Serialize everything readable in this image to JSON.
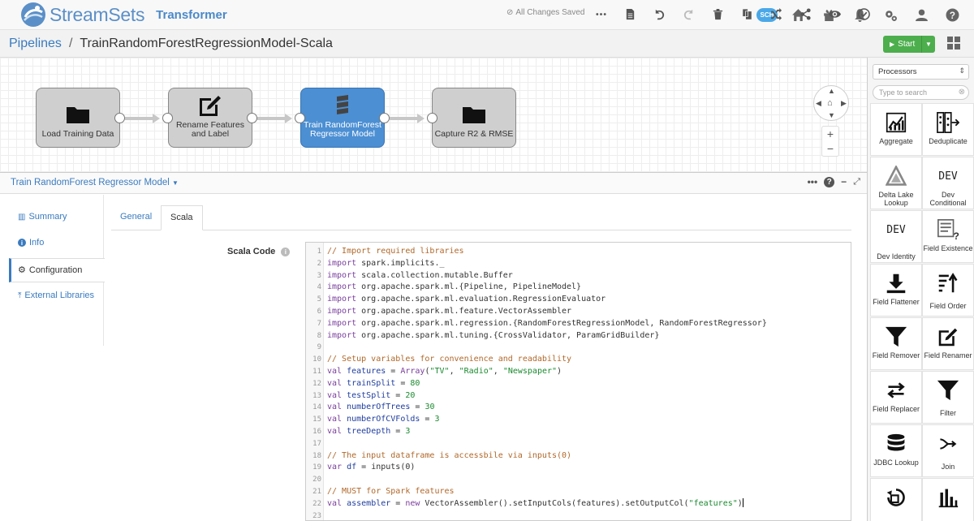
{
  "app": {
    "brand": "StreamSets",
    "product": "Transformer",
    "sch_badge": "SCH"
  },
  "breadcrumb": {
    "root": "Pipelines",
    "separator": "/",
    "pipeline_title": "TrainRandomForestRegressionModel-Scala"
  },
  "toolbar": {
    "saved_status": "All Changes Saved",
    "start_label": "Start"
  },
  "pipeline": {
    "stages": [
      {
        "label": "Load Training Data",
        "icon": "folder-icon"
      },
      {
        "label": "Rename Features and Label",
        "icon": "edit-icon"
      },
      {
        "label": "Train RandomForest Regressor Model",
        "icon": "scala-icon"
      },
      {
        "label": "Capture R2 & RMSE",
        "icon": "folder-icon"
      }
    ]
  },
  "config": {
    "title": "Train RandomForest Regressor Model",
    "nav": [
      {
        "label": "Summary",
        "icon": "bar-chart-icon"
      },
      {
        "label": "Info",
        "icon": "info-icon"
      },
      {
        "label": "Configuration",
        "icon": "gear-icon"
      },
      {
        "label": "External Libraries",
        "icon": "upload-icon"
      }
    ],
    "tabs": [
      "General",
      "Scala"
    ],
    "field_label": "Scala Code"
  },
  "code_lines": [
    "// Import required libraries",
    "import spark.implicits._",
    "import scala.collection.mutable.Buffer",
    "import org.apache.spark.ml.{Pipeline, PipelineModel}",
    "import org.apache.spark.ml.evaluation.RegressionEvaluator",
    "import org.apache.spark.ml.feature.VectorAssembler",
    "import org.apache.spark.ml.regression.{RandomForestRegressionModel, RandomForestRegressor}",
    "import org.apache.spark.ml.tuning.{CrossValidator, ParamGridBuilder}",
    "",
    "// Setup variables for convenience and readability",
    "val features = Array(\"TV\", \"Radio\", \"Newspaper\")",
    "val trainSplit = 80",
    "val testSplit = 20",
    "val numberOfTrees = 30",
    "val numberOfCVFolds = 3",
    "val treeDepth = 3",
    "",
    "// The input dataframe is accessbile via inputs(0)",
    "var df = inputs(0)",
    "",
    "// MUST for Spark features",
    "val assembler = new VectorAssembler().setInputCols(features).setOutputCol(\"features\")",
    ""
  ],
  "palette": {
    "category": "Processors",
    "search_placeholder": "Type to search",
    "items": [
      {
        "label": "Aggregate",
        "icon": "aggregate-icon"
      },
      {
        "label": "Deduplicate",
        "icon": "deduplicate-icon"
      },
      {
        "label": "Delta Lake Lookup",
        "icon": "delta-lake-icon"
      },
      {
        "label": "Dev Conditional",
        "icon": "dev-icon"
      },
      {
        "label": "Dev Identity",
        "icon": "dev-icon"
      },
      {
        "label": "Field Existence",
        "icon": "field-existence-icon"
      },
      {
        "label": "Field Flattener",
        "icon": "download-icon"
      },
      {
        "label": "Field Order",
        "icon": "sort-icon"
      },
      {
        "label": "Field Remover",
        "icon": "filter-icon"
      },
      {
        "label": "Field Renamer",
        "icon": "edit-icon"
      },
      {
        "label": "Field Replacer",
        "icon": "swap-icon"
      },
      {
        "label": "Filter",
        "icon": "filter-icon"
      },
      {
        "label": "JDBC Lookup",
        "icon": "database-icon"
      },
      {
        "label": "Join",
        "icon": "join-icon"
      },
      {
        "label": "",
        "icon": "repartition-icon"
      },
      {
        "label": "",
        "icon": "profile-icon"
      }
    ],
    "dev_text": "DEV"
  }
}
